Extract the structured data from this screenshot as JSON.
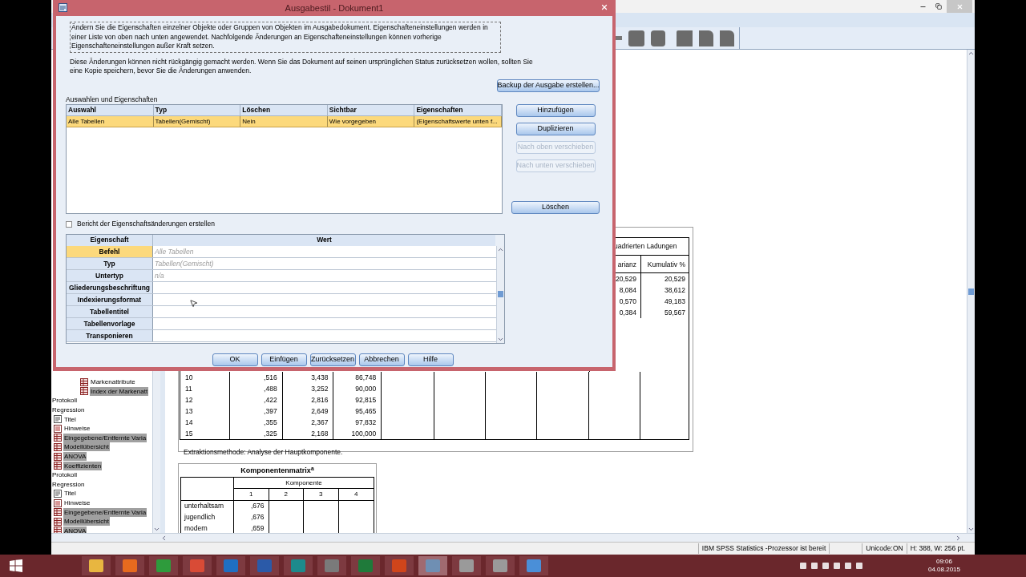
{
  "app": {
    "status_bar": [
      "IBM SPSS Statistics -Prozessor ist bereit",
      "Unicode:ON",
      "H: 388, W: 256 pt."
    ]
  },
  "outline": {
    "partial": [
      {
        "label": "Markenattribute",
        "kind": "table",
        "selected": false
      },
      {
        "label": "Index der Markenatt",
        "kind": "table",
        "selected": true
      }
    ],
    "items": [
      {
        "label": "Protokoll",
        "selected": false
      },
      {
        "label": "Regression",
        "selected": false,
        "children": [
          {
            "label": "Titel",
            "kind": "title",
            "selected": false
          },
          {
            "label": "Hinweise",
            "kind": "notes",
            "selected": false
          },
          {
            "label": "Eingegebene/Entfernte Varia",
            "kind": "table",
            "selected": true
          },
          {
            "label": "Modellübersicht",
            "kind": "table",
            "selected": true
          },
          {
            "label": "ANOVA",
            "kind": "table",
            "selected": true
          },
          {
            "label": "Koeffizienten",
            "kind": "table",
            "selected": true
          }
        ]
      },
      {
        "label": "Protokoll",
        "selected": false
      },
      {
        "label": "Regression",
        "selected": false,
        "children": [
          {
            "label": "Titel",
            "kind": "title",
            "selected": false
          },
          {
            "label": "Hinweise",
            "kind": "notes",
            "selected": false
          },
          {
            "label": "Eingegebene/Entfernte Varia",
            "kind": "table",
            "selected": true
          },
          {
            "label": "Modellübersicht",
            "kind": "table",
            "selected": true
          },
          {
            "label": "ANOVA",
            "kind": "table",
            "selected": true
          }
        ]
      }
    ]
  },
  "variance_table": {
    "header_fragment": "uadrierten Ladungen",
    "subheaders": [
      "arianz",
      "Kumulativ %"
    ],
    "upper_rows": [
      [
        "20,529",
        "20,529"
      ],
      [
        "8,084",
        "38,612"
      ],
      [
        "0,570",
        "49,183"
      ],
      [
        "0,384",
        "59,567"
      ]
    ],
    "lower_rows": [
      [
        "10",
        ",516",
        "3,438",
        "86,748"
      ],
      [
        "11",
        ",488",
        "3,252",
        "90,000"
      ],
      [
        "12",
        ",422",
        "2,816",
        "92,815"
      ],
      [
        "13",
        ",397",
        "2,649",
        "95,465"
      ],
      [
        "14",
        ",355",
        "2,367",
        "97,832"
      ],
      [
        "15",
        ",325",
        "2,168",
        "100,000"
      ]
    ],
    "footnote": "Extraktionsmethode: Analyse der Hauptkomponente."
  },
  "component_matrix": {
    "title": "Komponentenmatrix$^{a}$",
    "group_header": "Komponente",
    "columns": [
      "1",
      "2",
      "3",
      "4"
    ],
    "rows": [
      {
        "label": "unterhaltsam",
        "values": [
          ",676"
        ]
      },
      {
        "label": "jugendlich",
        "values": [
          ",676"
        ]
      },
      {
        "label": "modern",
        "values": [
          ",659"
        ]
      }
    ]
  },
  "dialog": {
    "title": "Ausgabestil - Dokument1",
    "intro": "Ändern Sie die Eigenschaften einzelner Objekte oder Gruppen von Objekten im Ausgabedokument. Eigenschafteneinstellungen werden in einer Liste von oben nach unten angewendet. Nachfolgende Änderungen an Eigenschafteneinstellungen können vorherige Eigenschafteneinstellungen außer Kraft setzen.",
    "warning": "Diese Änderungen können nicht rückgängig gemacht werden. Wenn Sie das Dokument auf seinen ursprünglichen Status zurücksetzen wollen, sollten Sie eine Kopie speichern, bevor Sie die Änderungen anwenden.",
    "backup_button": "Backup der Ausgabe erstellen...",
    "section_label": "Auswahlen und Eigenschaften",
    "columns": [
      "Auswahl",
      "Typ",
      "Löschen",
      "Sichtbar",
      "Eigenschaften"
    ],
    "rows": [
      {
        "cells": [
          "Alle Tabellen",
          "Tabellen(Gemischt)",
          "Nein",
          "Wie vorgegeben",
          "(Eigenschaftswerte unten f..."
        ],
        "selected": true
      }
    ],
    "side_buttons": [
      {
        "label": "Hinzufügen",
        "disabled": false
      },
      {
        "label": "Duplizieren",
        "disabled": false
      },
      {
        "label": "Nach oben verschieben",
        "disabled": true
      },
      {
        "label": "Nach unten verschieben",
        "disabled": true
      }
    ],
    "delete_button": "Löschen",
    "report_checkbox": {
      "label": "Bericht der Eigenschaftsänderungen erstellen",
      "checked": false
    },
    "property_columns": [
      "Eigenschaft",
      "Wert"
    ],
    "properties": [
      {
        "name": "Befehl",
        "value": "Alle Tabellen",
        "selected": true
      },
      {
        "name": "Typ",
        "value": "Tabellen(Gemischt)",
        "selected": false
      },
      {
        "name": "Untertyp",
        "value": "n/a",
        "selected": false
      },
      {
        "name": "Gliederungsbeschriftung",
        "selected": false
      },
      {
        "name": "Indexierungsformat",
        "selected": false
      },
      {
        "name": "Tabellentitel",
        "selected": false
      },
      {
        "name": "Tabellenvorlage",
        "selected": false
      },
      {
        "name": "Transponieren",
        "selected": false
      }
    ],
    "buttons": [
      "OK",
      "Einfügen",
      "Zurücksetzen",
      "Abbrechen",
      "Hilfe"
    ]
  },
  "taskbar": {
    "time": "09:06",
    "date": "04.08.2015"
  }
}
